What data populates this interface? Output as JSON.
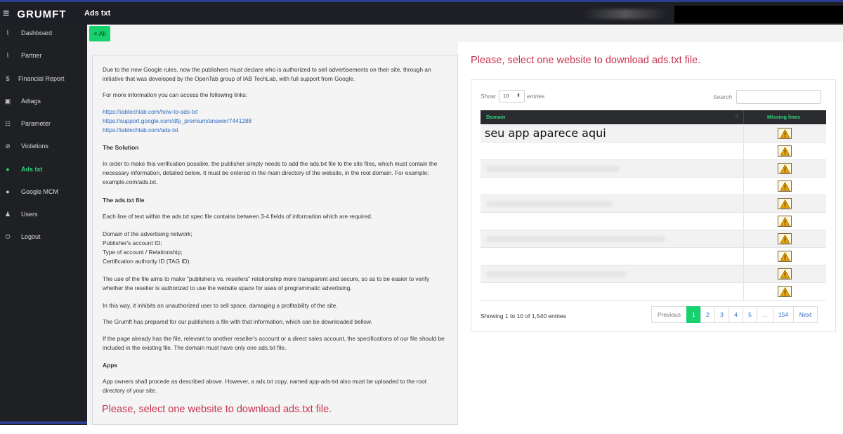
{
  "app": {
    "brand": "GRUMFT",
    "menu_icon": "hamburger-icon",
    "page_title": "Ads txt"
  },
  "sidebar": {
    "items": [
      {
        "label": "Dashboard",
        "icon": "chart-line-icon",
        "glyph": "⌇"
      },
      {
        "label": "Partner",
        "icon": "chart-line-icon",
        "glyph": "⌇"
      },
      {
        "label": "Financial Report",
        "icon": "dollar-icon",
        "glyph": "$"
      },
      {
        "label": "Adtags",
        "icon": "tag-icon",
        "glyph": "▣"
      },
      {
        "label": "Parameter",
        "icon": "sliders-icon",
        "glyph": "☷"
      },
      {
        "label": "Violations",
        "icon": "ban-icon",
        "glyph": "⊘"
      },
      {
        "label": "Ads txt",
        "icon": "circle-dot-icon",
        "glyph": "●",
        "active": true
      },
      {
        "label": "Google MCM",
        "icon": "info-circle-icon",
        "glyph": "●"
      },
      {
        "label": "Users",
        "icon": "user-icon",
        "glyph": "♟"
      },
      {
        "label": "Logout",
        "icon": "power-icon",
        "glyph": "⏻"
      }
    ]
  },
  "filter": {
    "all_label": "× All"
  },
  "info": {
    "intro": "Due to the new Google rules, now the publishers must declare who is authorized to sell advertisements on their site, through an initiative that was developed by the OpenTab group of IAB TechLab, with full support from Google.",
    "more_info": "For more information you can access the following links:",
    "links": [
      "https://iabtechlab.com/how-to-ads-txt",
      "https://support.google.com/dfp_premium/answer/7441288",
      "https://iabtechlab.com/ads-txt"
    ],
    "solution_heading": "The Solution",
    "solution_text": "In order to make this verification possible, the publisher simply needs to add the ads.txt file to the site files, which must contain the necessary information, detailed below. It must be entered in the main directory of the website, in the root domain. For example: example.com/ads.txt.",
    "file_heading": "The ads.txt file",
    "file_text": "Each line of text within the ads.txt spec file contains between 3-4 fields of information which are required.",
    "fields": [
      "Domain of the advertising network;",
      "Publisher's account ID;",
      "Type of account / Relationship;",
      "Certification authority ID (TAG ID)."
    ],
    "use_text": "The use of the file aims to make \"publishers vs. resellers\" relationship more transparent and secure, so as to be easier to verify whether the reseller is authorized to use the website space for uses of programmatic advertising.",
    "inhibits_text": "In this way, it inhibits an unauthorized user to sell space, damaging a profitability of the site.",
    "grumft_text": "The Grumft has prepared for our publishers a file with that information, which can be downloaded bellow.",
    "already_text": "If the page already has the file, relevant to another reseller's account or a direct sales account, the specifications of our file should be included in the existing file. The domain must have only one ads.txt file.",
    "apps_heading": "Apps",
    "apps_text": "App owners shall procede as described above. However, a adx.txt copy, named app-ads-txt also must be uploaded to the root directory of your site.",
    "select_prompt": "Please, select one website to download ads.txt file."
  },
  "table": {
    "title": "Please, select one website to download ads.txt file.",
    "show_label": "Show",
    "page_size": "10",
    "entries_label": "entries",
    "search_label": "Search",
    "search_value": "",
    "columns": {
      "domain": "Domain",
      "missing": "Missing lines"
    },
    "overlay_text": "seu app aparece aqui",
    "rows": [
      {
        "status": "warning-icon"
      },
      {
        "status": "warning-icon"
      },
      {
        "status": "warning-icon"
      },
      {
        "status": "warning-icon"
      },
      {
        "status": "warning-icon"
      },
      {
        "status": "warning-icon"
      },
      {
        "status": "warning-icon"
      },
      {
        "status": "warning-icon"
      },
      {
        "status": "warning-icon"
      },
      {
        "status": "warning-icon"
      }
    ],
    "info": "Showing 1 to 10 of 1,540 entries",
    "pagination": {
      "previous": "Previous",
      "pages": [
        "1",
        "2",
        "3",
        "4",
        "5"
      ],
      "ellipsis": "…",
      "last": "154",
      "next": "Next",
      "current": "1"
    }
  },
  "colors": {
    "accent": "#17d16d",
    "prompt_red": "#c8334e",
    "link_blue": "#2d6bc0",
    "topbar": "#1e1f24"
  }
}
